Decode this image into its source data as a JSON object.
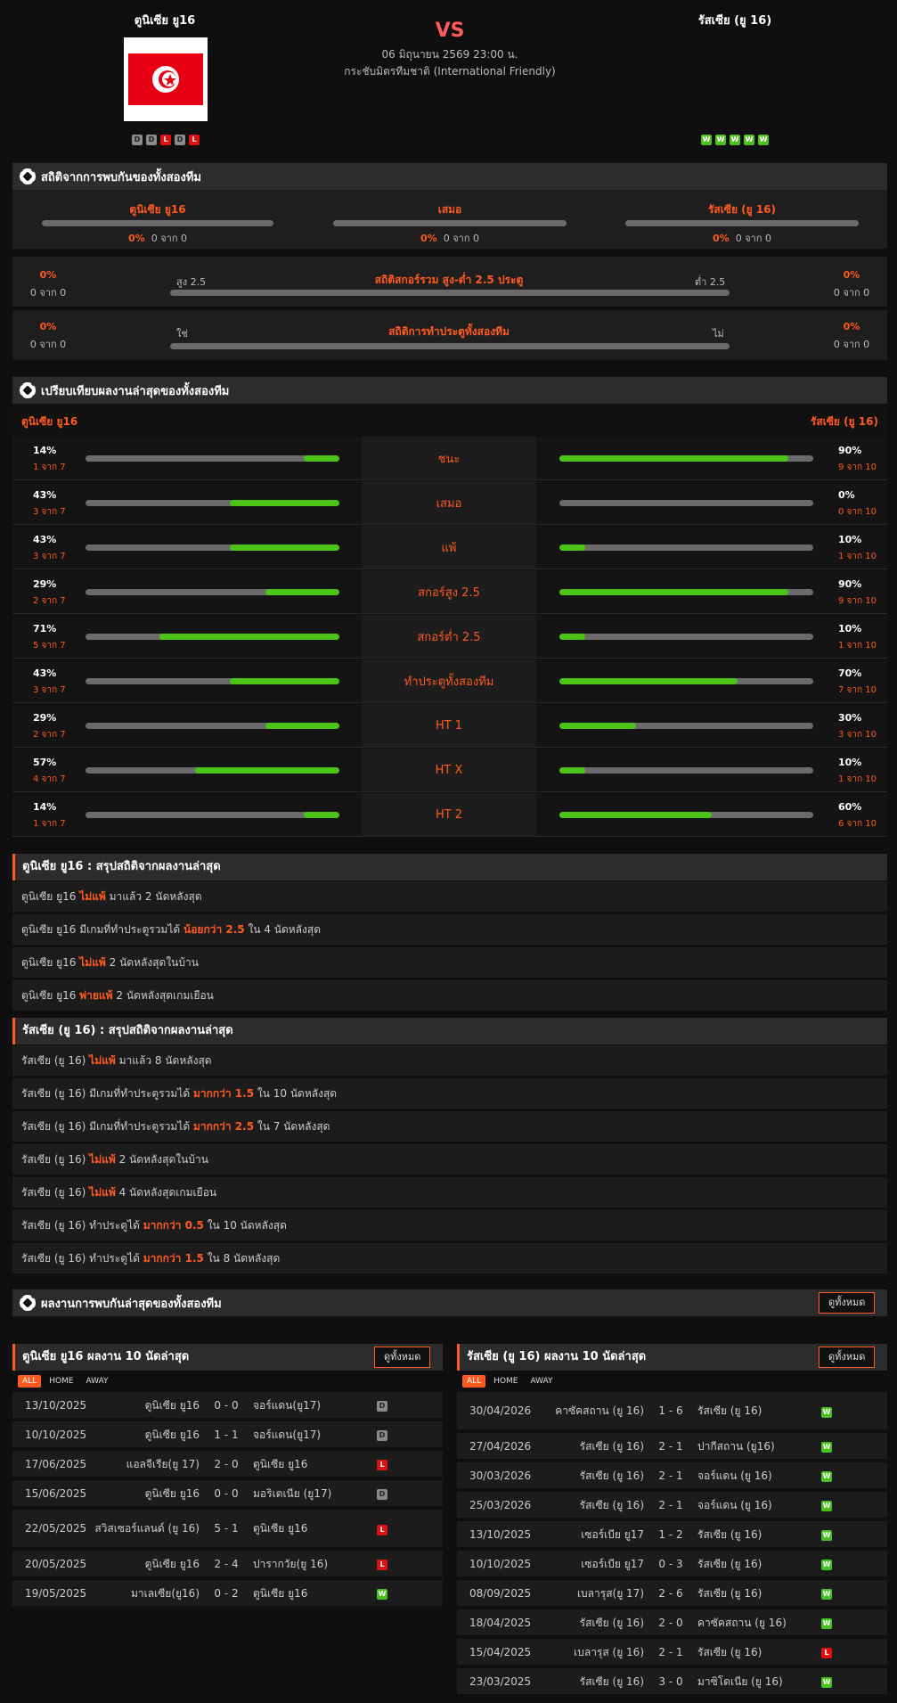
{
  "header": {
    "home_name": "ตูนิเซีย ยู16",
    "away_name": "รัสเซีย (ยู 16)",
    "vs": "VS",
    "datetime": "06 มิถุนายน 2569 23:00 น.",
    "competition": "กระชับมิตรทีมชาติ (International Friendly)",
    "home_form": [
      "D",
      "D",
      "L",
      "D",
      "L"
    ],
    "away_form": [
      "W",
      "W",
      "W",
      "W",
      "W"
    ],
    "colors": {
      "accent": "#ff5a1f",
      "win": "#48c020",
      "loss": "#e01010",
      "draw": "#8a8a8a",
      "bar": "#4cc417"
    }
  },
  "h2h": {
    "title": "สถิติจากการพบกันของทั้งสองทีม",
    "home_label": "ตูนิเซีย ยู16",
    "draw_label": "เสมอ",
    "away_label": "รัสเซีย (ยู 16)",
    "home_pct": "0%",
    "home_cnt": "0 จาก 0",
    "draw_pct": "0%",
    "draw_cnt": "0 จาก 0",
    "away_pct": "0%",
    "away_cnt": "0 จาก 0",
    "ou": {
      "title": "สถิติสกอร์รวม สูง-ต่ำ 2.5 ประตู",
      "left": "สูง 2.5",
      "right": "ต่ำ 2.5",
      "lp": "0%",
      "lc": "0 จาก 0",
      "rp": "0%",
      "rc": "0 จาก 0"
    },
    "btts": {
      "title": "สถิติการทำประตูทั้งสองทีม",
      "left": "ใช่",
      "right": "ไม่",
      "lp": "0%",
      "lc": "0 จาก 0",
      "rp": "0%",
      "rc": "0 จาก 0"
    }
  },
  "compare": {
    "title": "เปรียบเทียบผลงานล่าสุดของทั้งสองทีม",
    "home": "ตูนิเซีย ยู16",
    "away": "รัสเซีย (ยู 16)",
    "rows": [
      {
        "label": "ชนะ",
        "hp": "14%",
        "hc": "1 จาก 7",
        "hv": 0.14,
        "ap": "90%",
        "ac": "9 จาก 10",
        "av": 0.9
      },
      {
        "label": "เสมอ",
        "hp": "43%",
        "hc": "3 จาก 7",
        "hv": 0.43,
        "ap": "0%",
        "ac": "0 จาก 10",
        "av": 0
      },
      {
        "label": "แพ้",
        "hp": "43%",
        "hc": "3 จาก 7",
        "hv": 0.43,
        "ap": "10%",
        "ac": "1 จาก 10",
        "av": 0.1
      },
      {
        "label": "สกอร์สูง 2.5",
        "hp": "29%",
        "hc": "2 จาก 7",
        "hv": 0.29,
        "ap": "90%",
        "ac": "9 จาก 10",
        "av": 0.9
      },
      {
        "label": "สกอร์ต่ำ 2.5",
        "hp": "71%",
        "hc": "5 จาก 7",
        "hv": 0.71,
        "ap": "10%",
        "ac": "1 จาก 10",
        "av": 0.1
      },
      {
        "label": "ทำประตูทั้งสองทีม",
        "hp": "43%",
        "hc": "3 จาก 7",
        "hv": 0.43,
        "ap": "70%",
        "ac": "7 จาก 10",
        "av": 0.7
      },
      {
        "label": "HT 1",
        "hp": "29%",
        "hc": "2 จาก 7",
        "hv": 0.29,
        "ap": "30%",
        "ac": "3 จาก 10",
        "av": 0.3
      },
      {
        "label": "HT X",
        "hp": "57%",
        "hc": "4 จาก 7",
        "hv": 0.57,
        "ap": "10%",
        "ac": "1 จาก 10",
        "av": 0.1
      },
      {
        "label": "HT 2",
        "hp": "14%",
        "hc": "1 จาก 7",
        "hv": 0.14,
        "ap": "60%",
        "ac": "6 จาก 10",
        "av": 0.6
      }
    ]
  },
  "home_summary": {
    "title": "ตูนิเซีย ยู16 : สรุปสถิติจากผลงานล่าสุด",
    "rows": [
      [
        "ตูนิเซีย ยู16",
        "ไม่แพ้",
        "มาแล้ว 2 นัดหลังสุด"
      ],
      [
        "ตูนิเซีย ยู16  มีเกมที่ทำประตูรวมได้",
        "น้อยกว่า  2.5",
        "ใน 4 นัดหลังสุด"
      ],
      [
        "ตูนิเซีย ยู16",
        "ไม่แพ้",
        "2  นัดหลังสุดในบ้าน"
      ],
      [
        "ตูนิเซีย ยู16",
        "พ่ายแพ้",
        "2  นัดหลังสุดเกมเยือน"
      ]
    ]
  },
  "away_summary": {
    "title": "รัสเซีย (ยู 16) : สรุปสถิติจากผลงานล่าสุด",
    "rows": [
      [
        "รัสเซีย (ยู 16)",
        "ไม่แพ้",
        "มาแล้ว 8 นัดหลังสุด"
      ],
      [
        "รัสเซีย (ยู 16)  มีเกมที่ทำประตูรวมได้",
        "มากกว่า  1.5",
        "ใน 10 นัดหลังสุด"
      ],
      [
        "รัสเซีย (ยู 16)  มีเกมที่ทำประตูรวมได้",
        "มากกว่า  2.5",
        "ใน 7 นัดหลังสุด"
      ],
      [
        "รัสเซีย (ยู 16)",
        "ไม่แพ้",
        "2  นัดหลังสุดในบ้าน"
      ],
      [
        "รัสเซีย (ยู 16)",
        "ไม่แพ้",
        "4  นัดหลังสุดเกมเยือน"
      ],
      [
        "รัสเซีย (ยู 16)  ทำประตูได้",
        "มากกว่า  0.5",
        "ใน 10 นัดหลังสุด"
      ],
      [
        "รัสเซีย (ยู 16)  ทำประตูได้",
        "มากกว่า  1.5",
        "ใน 8 นัดหลังสุด"
      ]
    ]
  },
  "recent": {
    "title": "ผลงานการพบกันล่าสุดของทั้งสองทีม",
    "view_all": "ดูทั้งหมด",
    "tabs": [
      "ALL",
      "HOME",
      "AWAY"
    ],
    "home_title": "ตูนิเซีย ยู16 ผลงาน 10 นัดล่าสุด",
    "away_title": "รัสเซีย (ยู 16) ผลงาน 10 นัดล่าสุด",
    "home_matches": [
      [
        "13/10/2025",
        "ตูนิเซีย ยู16",
        "0 - 0",
        "จอร์แดน(ยู17)",
        "D"
      ],
      [
        "10/10/2025",
        "ตูนิเซีย ยู16",
        "1 - 1",
        "จอร์แดน(ยู17)",
        "D"
      ],
      [
        "17/06/2025",
        "แอลจีเรีย(ยู 17)",
        "2 - 0",
        "ตูนิเซีย ยู16",
        "L"
      ],
      [
        "15/06/2025",
        "ตูนิเซีย ยู16",
        "0 - 0",
        "มอริเตเนีย (ยู17)",
        "D"
      ],
      [
        "22/05/2025",
        "สวิสเซอร์แลนด์ (ยู 16)",
        "5 - 1",
        "ตูนิเซีย ยู16",
        "L"
      ],
      [
        "20/05/2025",
        "ตูนิเซีย ยู16",
        "2 - 4",
        "ปารากวัย(ยู 16)",
        "L"
      ],
      [
        "19/05/2025",
        "มาเลเซีย(ยู16)",
        "0 - 2",
        "ตูนิเซีย ยู16",
        "W"
      ]
    ],
    "away_matches": [
      [
        "30/04/2026",
        "คาซัคสถาน (ยู 16)",
        "1 - 6",
        "รัสเซีย (ยู 16)",
        "W"
      ],
      [
        "27/04/2026",
        "รัสเซีย (ยู 16)",
        "2 - 1",
        "ปากีสถาน (ยู16)",
        "W"
      ],
      [
        "30/03/2026",
        "รัสเซีย (ยู 16)",
        "2 - 1",
        "จอร์แดน (ยู 16)",
        "W"
      ],
      [
        "25/03/2026",
        "รัสเซีย (ยู 16)",
        "2 - 1",
        "จอร์แดน (ยู 16)",
        "W"
      ],
      [
        "13/10/2025",
        "เซอร์เบีย ยู17",
        "1 - 2",
        "รัสเซีย (ยู 16)",
        "W"
      ],
      [
        "10/10/2025",
        "เซอร์เบีย ยู17",
        "0 - 3",
        "รัสเซีย (ยู 16)",
        "W"
      ],
      [
        "08/09/2025",
        "เบลารุส(ยู 17)",
        "2 - 6",
        "รัสเซีย (ยู 16)",
        "W"
      ],
      [
        "18/04/2025",
        "รัสเซีย (ยู 16)",
        "2 - 0",
        "คาซัคสถาน (ยู 16)",
        "W"
      ],
      [
        "15/04/2025",
        "เบลารุส (ยู 16)",
        "2 - 1",
        "รัสเซีย (ยู 16)",
        "L"
      ],
      [
        "23/03/2025",
        "รัสเซีย (ยู 16)",
        "3 - 0",
        "มาซิโดเนีย (ยู 16)",
        "W"
      ]
    ]
  }
}
